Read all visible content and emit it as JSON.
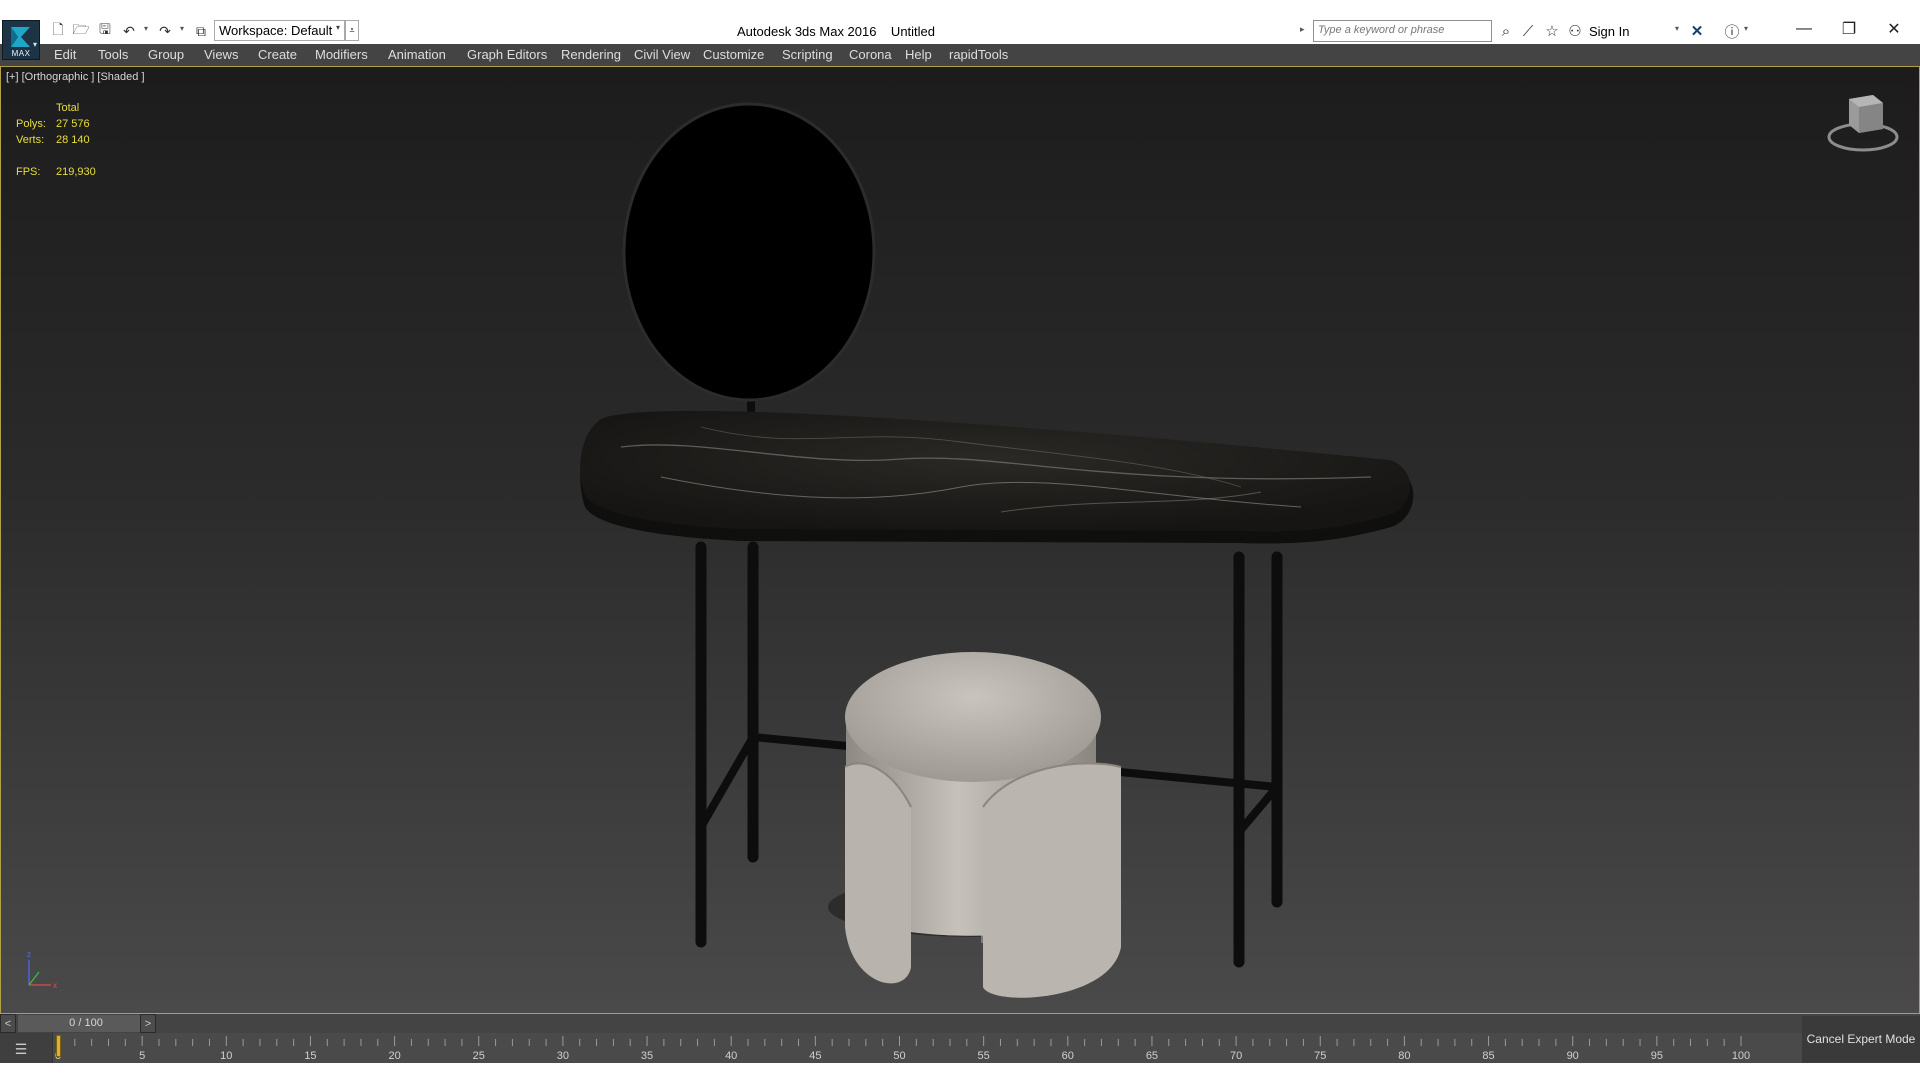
{
  "titlebar": {
    "logo_text": "MAX",
    "workspace": "Workspace: Default",
    "title": "Autodesk 3ds Max 2016    Untitled",
    "search_placeholder": "Type a keyword or phrase",
    "sign_in": "Sign In"
  },
  "menu": {
    "items": [
      "Edit",
      "Tools",
      "Group",
      "Views",
      "Create",
      "Modifiers",
      "Animation",
      "Graph Editors",
      "Rendering",
      "Civil View",
      "Customize",
      "Scripting",
      "Corona",
      "Help",
      "rapidTools"
    ]
  },
  "viewport": {
    "label": "[+] [Orthographic ] [Shaded ]",
    "stats": {
      "total_label": "Total",
      "polys_label": "Polys:",
      "polys": "27 576",
      "verts_label": "Verts:",
      "verts": "28 140",
      "fps_label": "FPS:",
      "fps": "219,930"
    },
    "colors": {
      "selection_border": "#b5a04a",
      "stats_text": "#e6df3a"
    }
  },
  "timeline": {
    "slider_text": "0 / 100",
    "prev": "<",
    "next": ">",
    "ticks": [
      "0",
      "5",
      "10",
      "15",
      "20",
      "25",
      "30",
      "35",
      "40",
      "45",
      "50",
      "55",
      "60",
      "65",
      "70",
      "75",
      "80",
      "85",
      "90",
      "95",
      "100"
    ],
    "current_frame": 0,
    "total_frames": 100
  },
  "cancel_expert": "Cancel Expert Mode"
}
